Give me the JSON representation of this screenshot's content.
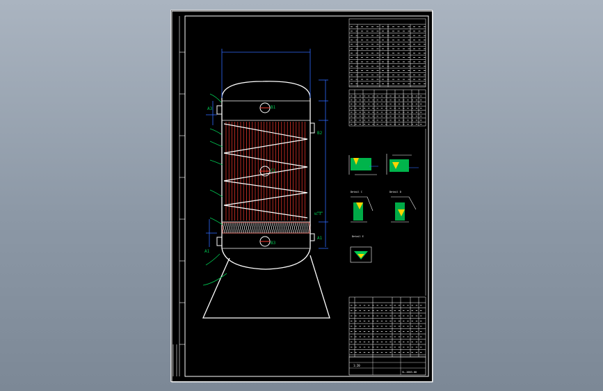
{
  "viewer": {
    "background": "#9aa5b2"
  },
  "colors": {
    "sheet": "#000000",
    "frame": "#ffffff",
    "dimension": "#2f6bff",
    "heat_coil": "#ff3b2f",
    "leader": "#00c853",
    "weld": "#ffd400"
  },
  "nozzle_labels": {
    "a3": "A3",
    "b1": "B1",
    "b2": "B2",
    "c1": "C1",
    "b3": "B3",
    "a1": "A1",
    "a1_lower": "A1",
    "side_note": "N1-4"
  },
  "title_block": {
    "drawing_no": "SL-2003-00",
    "scale": "1:20"
  },
  "details": {
    "weld_a": "Detail A",
    "weld_b": "Detail B",
    "weld_c": "Detail C",
    "weld_d": "Detail D",
    "weld_e": "Detail E"
  }
}
